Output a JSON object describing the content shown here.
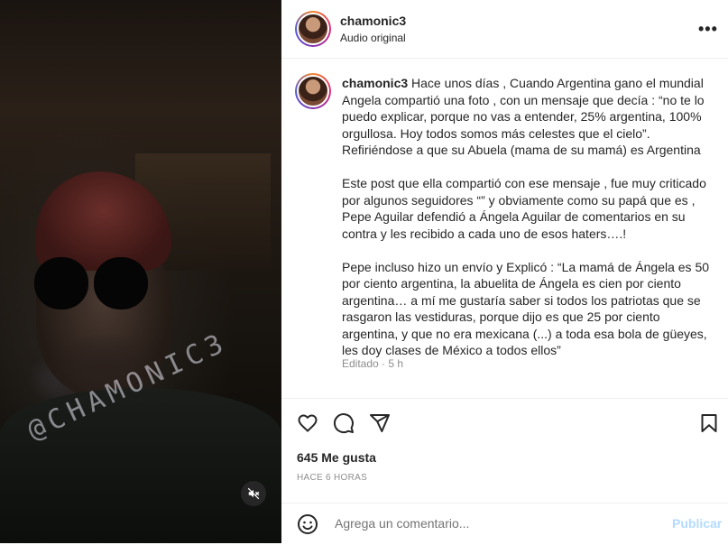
{
  "post": {
    "username": "chamonic3",
    "audio": "Audio original",
    "more_icon": "ellipsis-icon"
  },
  "media": {
    "watermark": "@CHAMONIC3",
    "mute_icon": "speaker-muted-icon"
  },
  "caption": {
    "username": "chamonic3",
    "text": " Hace unos días , Cuando Argentina gano el mundial Angela compartió una foto , con un mensaje que decía : “no te lo puedo explicar, porque no vas a entender, 25% argentina, 100% orgullosa. Hoy todos somos más celestes que el cielo”. Refiriéndose a que su Abuela (mama de su mamá) es Argentina\n\nEste post que ella compartió con ese mensaje , fue muy criticado por algunos seguidores “” y obviamente como su papá que es , Pepe Aguilar defendió a Ángela Aguilar de comentarios en su contra y les recibido a cada uno de esos haters….!\n\nPepe incluso hizo un envío y Explicó : “La mamá de Ángela es 50 por ciento argentina, la abuelita de Ángela es cien por ciento argentina… a mí me gustaría saber si todos los patriotas que se rasgaron las vestiduras, porque dijo es que 25 por ciento argentina, y que no era mexicana (...) a toda esa bola de güeyes, les doy clases de México a todos ellos”",
    "edited": "Editado · 5 h"
  },
  "actions": {
    "icons": [
      "heart-icon",
      "comment-icon",
      "share-icon",
      "bookmark-icon"
    ],
    "likes": "645 Me gusta",
    "time_ago": "HACE 6 HORAS"
  },
  "comment": {
    "emoji_icon": "smiley-icon",
    "placeholder": "Agrega un comentario...",
    "publish_label": "Publicar",
    "publish_color": "#b3dbff"
  }
}
